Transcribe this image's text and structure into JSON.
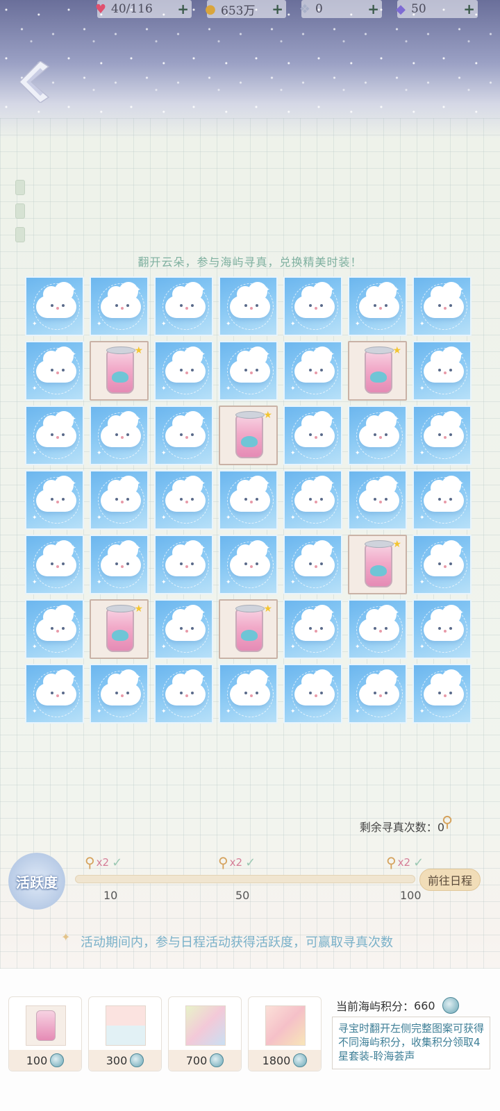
{
  "header": {
    "resources": [
      {
        "icon": "heart-gem-icon",
        "value": "40/116"
      },
      {
        "icon": "gold-coin-icon",
        "value": "653万"
      },
      {
        "icon": "crystal-icon",
        "value": "0"
      },
      {
        "icon": "diamond-icon",
        "value": "50"
      }
    ],
    "plus_label": "+"
  },
  "instruction": "翻开云朵，参与海屿寻真，兑换精美时装！",
  "board": {
    "rows": [
      [
        "cloud",
        "cloud",
        "cloud",
        "cloud",
        "cloud",
        "cloud",
        "cloud"
      ],
      [
        "cloud",
        "can",
        "cloud",
        "cloud",
        "cloud",
        "can",
        "cloud"
      ],
      [
        "cloud",
        "cloud",
        "cloud",
        "can",
        "cloud",
        "cloud",
        "cloud"
      ],
      [
        "cloud",
        "cloud",
        "cloud",
        "cloud",
        "cloud",
        "cloud",
        "cloud"
      ],
      [
        "cloud",
        "cloud",
        "cloud",
        "cloud",
        "cloud",
        "can",
        "cloud"
      ],
      [
        "cloud",
        "can",
        "cloud",
        "can",
        "cloud",
        "cloud",
        "cloud"
      ],
      [
        "cloud",
        "cloud",
        "cloud",
        "cloud",
        "cloud",
        "cloud",
        "cloud"
      ]
    ]
  },
  "remaining": {
    "label": "剩余寻真次数：",
    "value": "0"
  },
  "activity": {
    "badge_text": "活跃度",
    "progress_value": 0,
    "milestones": [
      {
        "value": "10",
        "reward": "x2"
      },
      {
        "value": "50",
        "reward": "x2"
      },
      {
        "value": "100",
        "reward": "x2"
      }
    ],
    "goto_label": "前往日程",
    "hint": "活动期间内，参与日程活动获得活跃度，可赢取寻真次数"
  },
  "exchange": {
    "cards": [
      {
        "cost": "100"
      },
      {
        "cost": "300"
      },
      {
        "cost": "700"
      },
      {
        "cost": "1800"
      }
    ],
    "score_label": "当前海屿积分：",
    "score_value": "660",
    "description": "寻宝时翻开左侧完整图案可获得不同海屿积分，收集积分领取4星套装-聆海荟声"
  },
  "colors": {
    "accent_blue": "#7ab1c9",
    "tile_blue": "#86c7f4",
    "button_gold": "#f1ddb8"
  }
}
